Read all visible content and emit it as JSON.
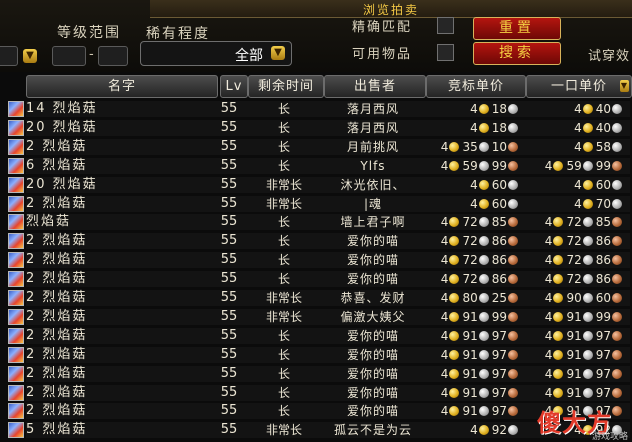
{
  "header": {
    "title": "浏览拍卖",
    "level_range_label": "等级范围",
    "rarity_label": "稀有程度",
    "rarity_value": "全部",
    "exact_match_label": "精确匹配",
    "usable_label": "可用物品",
    "reset_button": "重置",
    "search_button": "搜索",
    "try_on_label": "试穿效",
    "level_dash": "-"
  },
  "columns": {
    "name": "名字",
    "lv": "Lv",
    "time_left": "剩余时间",
    "seller": "出售者",
    "bid": "竞标单价",
    "buyout": "一口单价"
  },
  "rows": [
    {
      "name": "14 烈焰菇",
      "lv": "55",
      "time": "长",
      "seller": "落月西风",
      "bid_g": "4",
      "bid_s": "18",
      "bid_c": "",
      "buy_g": "4",
      "buy_s": "40",
      "buy_c": ""
    },
    {
      "name": "20 烈焰菇",
      "lv": "55",
      "time": "长",
      "seller": "落月西风",
      "bid_g": "4",
      "bid_s": "18",
      "bid_c": "",
      "buy_g": "4",
      "buy_s": "40",
      "buy_c": ""
    },
    {
      "name": "2 烈焰菇",
      "lv": "55",
      "time": "长",
      "seller": "月前挑风",
      "bid_g": "4",
      "bid_s": "35",
      "bid_c": "10",
      "buy_g": "4",
      "buy_s": "58",
      "buy_c": ""
    },
    {
      "name": "6 烈焰菇",
      "lv": "55",
      "time": "长",
      "seller": "Ylfs",
      "bid_g": "4",
      "bid_s": "59",
      "bid_c": "99",
      "buy_g": "4",
      "buy_s": "59",
      "buy_c": "99"
    },
    {
      "name": "20 烈焰菇",
      "lv": "55",
      "time": "非常长",
      "seller": "沐光依旧、",
      "bid_g": "4",
      "bid_s": "60",
      "bid_c": "",
      "buy_g": "4",
      "buy_s": "60",
      "buy_c": ""
    },
    {
      "name": "2 烈焰菇",
      "lv": "55",
      "time": "非常长",
      "seller": "|魂",
      "bid_g": "4",
      "bid_s": "60",
      "bid_c": "",
      "buy_g": "4",
      "buy_s": "70",
      "buy_c": ""
    },
    {
      "name": "烈焰菇",
      "lv": "55",
      "time": "长",
      "seller": "墙上君子啊",
      "bid_g": "4",
      "bid_s": "72",
      "bid_c": "85",
      "buy_g": "4",
      "buy_s": "72",
      "buy_c": "85"
    },
    {
      "name": "2 烈焰菇",
      "lv": "55",
      "time": "长",
      "seller": "爱你的喵",
      "bid_g": "4",
      "bid_s": "72",
      "bid_c": "86",
      "buy_g": "4",
      "buy_s": "72",
      "buy_c": "86"
    },
    {
      "name": "2 烈焰菇",
      "lv": "55",
      "time": "长",
      "seller": "爱你的喵",
      "bid_g": "4",
      "bid_s": "72",
      "bid_c": "86",
      "buy_g": "4",
      "buy_s": "72",
      "buy_c": "86"
    },
    {
      "name": "2 烈焰菇",
      "lv": "55",
      "time": "长",
      "seller": "爱你的喵",
      "bid_g": "4",
      "bid_s": "72",
      "bid_c": "86",
      "buy_g": "4",
      "buy_s": "72",
      "buy_c": "86"
    },
    {
      "name": "2 烈焰菇",
      "lv": "55",
      "time": "非常长",
      "seller": "恭喜、发财",
      "bid_g": "4",
      "bid_s": "80",
      "bid_c": "25",
      "buy_g": "4",
      "buy_s": "90",
      "buy_c": "60"
    },
    {
      "name": "2 烈焰菇",
      "lv": "55",
      "time": "非常长",
      "seller": "偏激大姨父",
      "bid_g": "4",
      "bid_s": "91",
      "bid_c": "99",
      "buy_g": "4",
      "buy_s": "91",
      "buy_c": "99"
    },
    {
      "name": "2 烈焰菇",
      "lv": "55",
      "time": "长",
      "seller": "爱你的喵",
      "bid_g": "4",
      "bid_s": "91",
      "bid_c": "97",
      "buy_g": "4",
      "buy_s": "91",
      "buy_c": "97"
    },
    {
      "name": "2 烈焰菇",
      "lv": "55",
      "time": "长",
      "seller": "爱你的喵",
      "bid_g": "4",
      "bid_s": "91",
      "bid_c": "97",
      "buy_g": "4",
      "buy_s": "91",
      "buy_c": "97"
    },
    {
      "name": "2 烈焰菇",
      "lv": "55",
      "time": "长",
      "seller": "爱你的喵",
      "bid_g": "4",
      "bid_s": "91",
      "bid_c": "97",
      "buy_g": "4",
      "buy_s": "91",
      "buy_c": "97"
    },
    {
      "name": "2 烈焰菇",
      "lv": "55",
      "time": "长",
      "seller": "爱你的喵",
      "bid_g": "4",
      "bid_s": "91",
      "bid_c": "97",
      "buy_g": "4",
      "buy_s": "91",
      "buy_c": "97"
    },
    {
      "name": "2 烈焰菇",
      "lv": "55",
      "time": "长",
      "seller": "爱你的喵",
      "bid_g": "4",
      "bid_s": "91",
      "bid_c": "97",
      "buy_g": "4",
      "buy_s": "91",
      "buy_c": "97"
    },
    {
      "name": "5 烈焰菇",
      "lv": "55",
      "time": "非常长",
      "seller": "孤云不是为云",
      "bid_g": "4",
      "bid_s": "92",
      "bid_c": "",
      "buy_g": "4",
      "buy_s": "92",
      "buy_c": ""
    }
  ],
  "watermark": {
    "logo": "傻大方",
    "sub": "游戏攻略"
  },
  "colors": {
    "title_gold": "#f3c845",
    "button_red": "#b4150f",
    "gold_coin": "#e0b020",
    "silver_coin": "#b4b4b4",
    "copper_coin": "#b86b3c"
  }
}
